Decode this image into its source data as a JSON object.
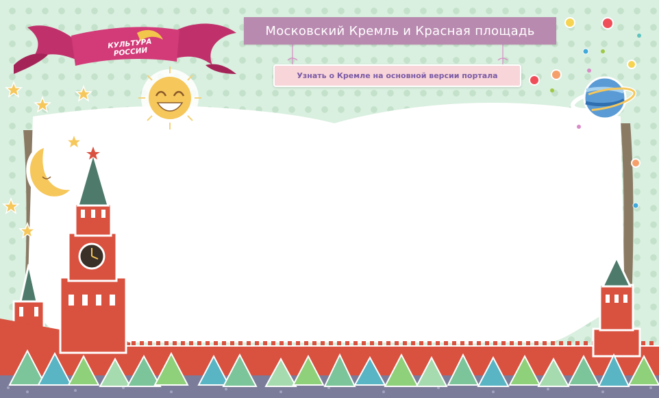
{
  "page": {
    "title": "Московский Кремль и Красная площадь",
    "portal_link": "Узнать о Кремле на основной версии портала"
  },
  "logo": {
    "line1": "КУЛЬТУРА",
    "line2": "РОССИИ"
  },
  "colors": {
    "background": "#d9efdf",
    "title_bg": "#b98ab0",
    "link_bg": "#f8d5d8",
    "link_text": "#7a5aa6",
    "kremlin_red": "#d9513f",
    "tree_green": "#7cc49a"
  },
  "icons": [
    "sun-icon",
    "moon-icon",
    "planet-icon",
    "star-icon",
    "clock-icon",
    "ribbon-banner"
  ]
}
